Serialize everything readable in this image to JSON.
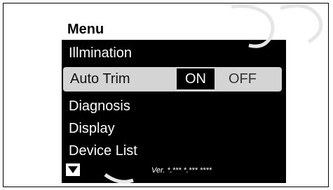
{
  "menu": {
    "title": "Menu",
    "items": [
      {
        "label": "Illmination"
      },
      {
        "label": "Auto Trim",
        "options": [
          "ON",
          "OFF"
        ],
        "selected_option": "ON"
      },
      {
        "label": "Diagnosis"
      },
      {
        "label": "Display"
      },
      {
        "label": "Device List"
      }
    ]
  },
  "footer": {
    "scroll_icon": "triangle-down-icon",
    "version": "Ver. *.*** *.*** ****"
  },
  "colors": {
    "screen_bg": "#000000",
    "text": "#ffffff",
    "highlight_row": "#d4d4d4"
  }
}
